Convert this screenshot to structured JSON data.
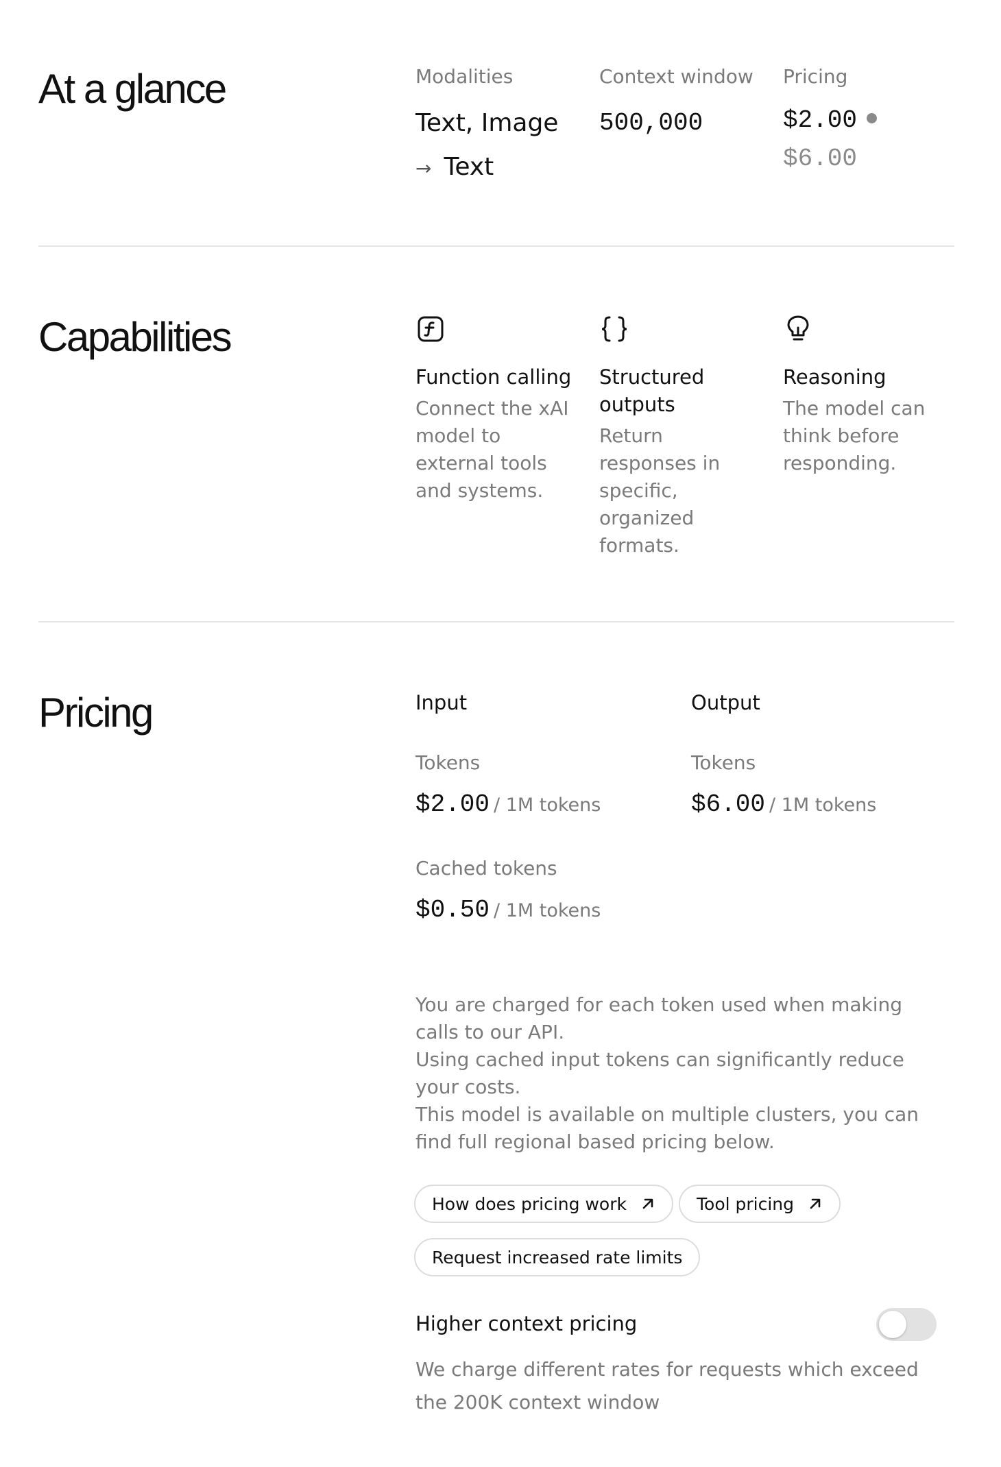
{
  "glance": {
    "title": "At a glance",
    "modalities_label": "Modalities",
    "modalities_line1": "Text, Image",
    "modalities_arrow": "→",
    "modalities_line2": "Text",
    "context_label": "Context window",
    "context_value": "500,000",
    "pricing_label": "Pricing",
    "pricing_input": "$2.00",
    "pricing_output": "$6.00"
  },
  "capabilities": {
    "title": "Capabilities",
    "items": [
      {
        "icon": "function-icon",
        "title": "Function calling",
        "desc": "Connect the xAI model to external tools and systems."
      },
      {
        "icon": "braces-icon",
        "title": "Structured outputs",
        "desc": "Return responses in specific, organized formats."
      },
      {
        "icon": "lightbulb-icon",
        "title": "Reasoning",
        "desc": "The model can think before responding."
      }
    ]
  },
  "pricing": {
    "title": "Pricing",
    "input_header": "Input",
    "output_header": "Output",
    "input_tokens_label": "Tokens",
    "input_tokens_value": "$2.00",
    "output_tokens_label": "Tokens",
    "output_tokens_value": "$6.00",
    "cached_label": "Cached tokens",
    "cached_value": "$0.50",
    "unit": "/ 1M tokens",
    "notes": [
      "You are charged for each token used when making calls to our API.",
      "Using cached input tokens can significantly reduce your costs.",
      "This model is available on multiple clusters, you can find full regional based pricing below."
    ],
    "links": {
      "how_pricing": "How does pricing work",
      "tool_pricing": "Tool pricing",
      "rate_limits": "Request increased rate limits"
    },
    "higher_context": {
      "label": "Higher context pricing",
      "desc": "We charge different rates for requests which exceed the 200K context window",
      "enabled": false
    }
  },
  "colors": {
    "text": "#111111",
    "muted": "#7a7a7a",
    "divider": "#e6e6e6",
    "toggle_off": "#e2e2e2"
  }
}
